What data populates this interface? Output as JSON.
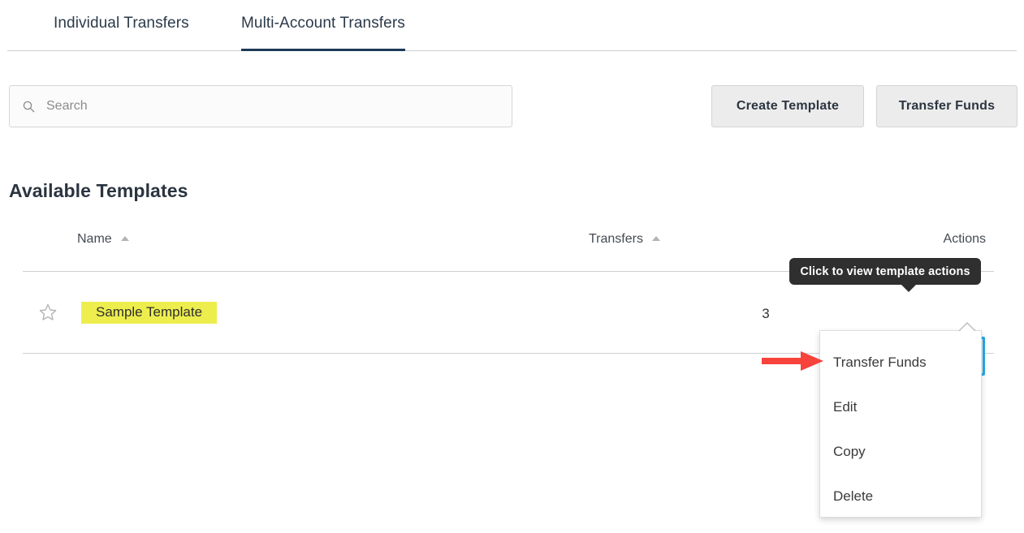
{
  "tabs": [
    {
      "label": "Individual Transfers",
      "active": false
    },
    {
      "label": "Multi-Account Transfers",
      "active": true
    }
  ],
  "toolbar": {
    "search": {
      "placeholder": "Search",
      "value": "",
      "icon": "search-icon"
    },
    "create_template_label": "Create Template",
    "transfer_funds_label": "Transfer Funds"
  },
  "section": {
    "title": "Available Templates"
  },
  "table": {
    "columns": [
      {
        "label": "Name",
        "sort": "asc"
      },
      {
        "label": "Transfers",
        "sort": "asc"
      },
      {
        "label": "Actions",
        "sort": "none"
      }
    ],
    "rows": [
      {
        "favorite_icon": "star-outline-icon",
        "name": "Sample Template",
        "name_highlighted": true,
        "transfers": "3",
        "actions_icon": "kebab-menu-icon"
      }
    ]
  },
  "tooltip": {
    "text": "Click to view template actions"
  },
  "menu": {
    "items": [
      {
        "label": "Transfer Funds"
      },
      {
        "label": "Edit"
      },
      {
        "label": "Copy"
      },
      {
        "label": "Delete"
      }
    ]
  },
  "annotation": {
    "arrow_icon": "red-right-arrow-icon",
    "arrow_color": "#f8423c"
  },
  "colors": {
    "active_tab_underline": "#1c3a57",
    "focus_ring": "#29a9e8",
    "highlight": "#edee4e",
    "tooltip_bg": "#2f2f2f",
    "button_bg": "#ececec"
  }
}
